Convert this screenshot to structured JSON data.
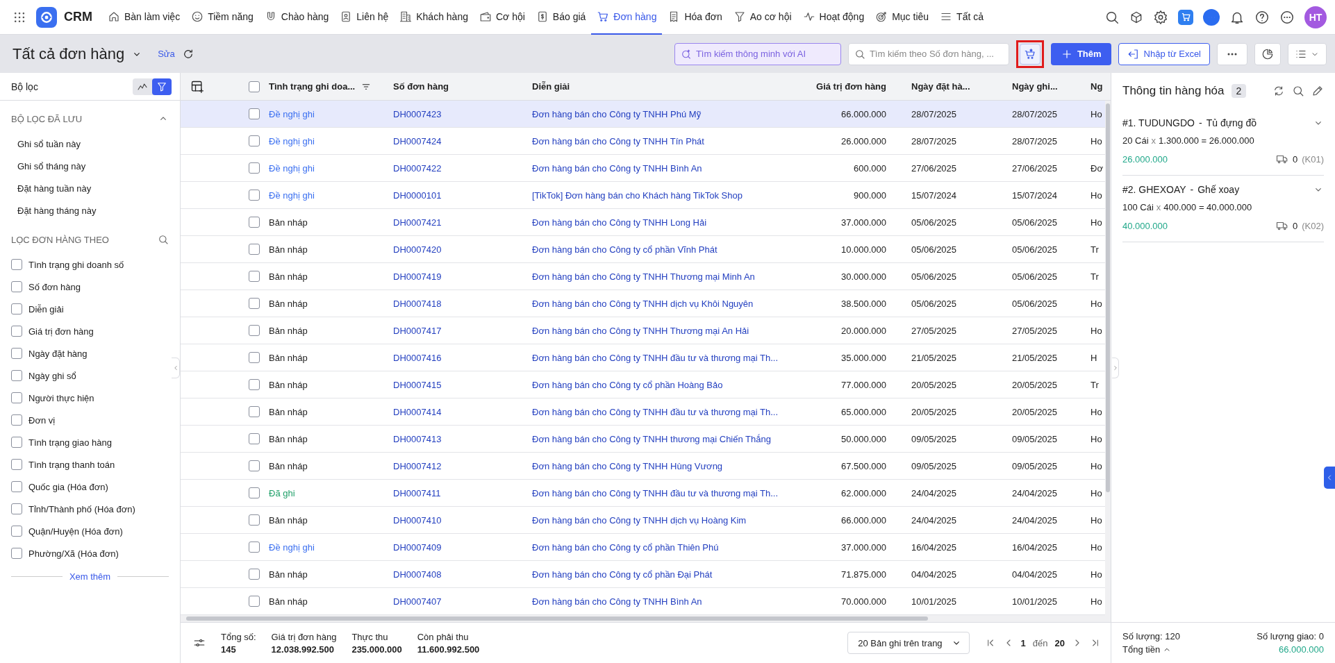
{
  "nav": {
    "brand": "CRM",
    "items": [
      {
        "label": "Bàn làm việc",
        "selected": false
      },
      {
        "label": "Tiềm năng",
        "selected": false
      },
      {
        "label": "Chào hàng",
        "selected": false
      },
      {
        "label": "Liên hệ",
        "selected": false
      },
      {
        "label": "Khách hàng",
        "selected": false
      },
      {
        "label": "Cơ hội",
        "selected": false
      },
      {
        "label": "Báo giá",
        "selected": false
      },
      {
        "label": "Đơn hàng",
        "selected": true
      },
      {
        "label": "Hóa đơn",
        "selected": false
      },
      {
        "label": "Ao cơ hội",
        "selected": false
      },
      {
        "label": "Hoạt động",
        "selected": false
      },
      {
        "label": "Mục tiêu",
        "selected": false
      },
      {
        "label": "Tất cả",
        "selected": false
      }
    ],
    "avatar": "HT"
  },
  "toolbar": {
    "title": "Tất cả đơn hàng",
    "edit_link": "Sửa",
    "ai_search": {
      "placeholder": "Tìm kiếm thông minh với AI"
    },
    "search": {
      "placeholder": "Tìm kiếm theo Số đơn hàng, ..."
    },
    "add_button": "Thêm",
    "import_button": "Nhập từ Excel"
  },
  "sidebar": {
    "title": "Bộ lọc",
    "view_toggle": [
      {
        "selected": false
      },
      {
        "selected": true
      }
    ],
    "saved_filters": {
      "title": "BỘ LỌC ĐÃ LƯU",
      "expanded": true,
      "items": [
        "Ghi sổ tuần này",
        "Ghi sổ tháng này",
        "Đặt hàng tuần này",
        "Đặt hàng tháng này"
      ]
    },
    "filter_by": {
      "title": "LỌC ĐƠN HÀNG THEO",
      "items": [
        {
          "label": "Tình trạng ghi doanh số",
          "checked": false
        },
        {
          "label": "Số đơn hàng",
          "checked": false
        },
        {
          "label": "Diễn giải",
          "checked": false
        },
        {
          "label": "Giá trị đơn hàng",
          "checked": false
        },
        {
          "label": "Ngày đặt hàng",
          "checked": false
        },
        {
          "label": "Ngày ghi sổ",
          "checked": false
        },
        {
          "label": "Người thực hiện",
          "checked": false
        },
        {
          "label": "Đơn vị",
          "checked": false
        },
        {
          "label": "Tình trạng giao hàng",
          "checked": false
        },
        {
          "label": "Tình trạng thanh toán",
          "checked": false
        },
        {
          "label": "Quốc gia (Hóa đơn)",
          "checked": false
        },
        {
          "label": "Tỉnh/Thành phố (Hóa đơn)",
          "checked": false
        },
        {
          "label": "Quận/Huyện (Hóa đơn)",
          "checked": false
        },
        {
          "label": "Phường/Xã (Hóa đơn)",
          "checked": false
        }
      ]
    },
    "more_link": "Xem thêm"
  },
  "table": {
    "select_all_checked": false,
    "columns": [
      "Tình trạng ghi doa...",
      "Số đơn hàng",
      "Diễn giải",
      "Giá trị đơn hàng",
      "Ngày đặt hà...",
      "Ngày ghi...",
      "Ng"
    ],
    "rows": [
      {
        "selected": true,
        "checked": false,
        "status": "Đề nghị ghi",
        "kind": "proposed",
        "number": "DH0007423",
        "description": "Đơn hàng bán cho Công ty TNHH Phú Mỹ",
        "value": "66.000.000",
        "order_date": "28/07/2025",
        "record_date": "28/07/2025",
        "column_7": "Ho"
      },
      {
        "selected": false,
        "checked": false,
        "status": "Đề nghị ghi",
        "kind": "proposed",
        "number": "DH0007424",
        "description": "Đơn hàng bán cho Công ty TNHH Tín Phát",
        "value": "26.000.000",
        "order_date": "28/07/2025",
        "record_date": "28/07/2025",
        "column_7": "Ho"
      },
      {
        "selected": false,
        "checked": false,
        "status": "Đề nghị ghi",
        "kind": "proposed",
        "number": "DH0007422",
        "description": "Đơn hàng bán cho Công ty TNHH Bình An",
        "value": "600.000",
        "order_date": "27/06/2025",
        "record_date": "27/06/2025",
        "column_7": "Đơ"
      },
      {
        "selected": false,
        "checked": false,
        "status": "Đề nghị ghi",
        "kind": "proposed",
        "number": "DH0000101",
        "description": "[TikTok] Đơn hàng bán cho Khách hàng TikTok Shop",
        "value": "900.000",
        "order_date": "15/07/2024",
        "record_date": "15/07/2024",
        "column_7": "Ho"
      },
      {
        "selected": false,
        "checked": false,
        "status": "Bản nháp",
        "kind": "draft",
        "number": "DH0007421",
        "description": "Đơn hàng bán cho Công ty TNHH Long Hải",
        "value": "37.000.000",
        "order_date": "05/06/2025",
        "record_date": "05/06/2025",
        "column_7": "Ho"
      },
      {
        "selected": false,
        "checked": false,
        "status": "Bản nháp",
        "kind": "draft",
        "number": "DH0007420",
        "description": "Đơn hàng bán cho Công ty cổ phần Vĩnh Phát",
        "value": "10.000.000",
        "order_date": "05/06/2025",
        "record_date": "05/06/2025",
        "column_7": "Tr"
      },
      {
        "selected": false,
        "checked": false,
        "status": "Bản nháp",
        "kind": "draft",
        "number": "DH0007419",
        "description": "Đơn hàng bán cho Công ty TNHH Thương mại Minh An",
        "value": "30.000.000",
        "order_date": "05/06/2025",
        "record_date": "05/06/2025",
        "column_7": "Tr"
      },
      {
        "selected": false,
        "checked": false,
        "status": "Bản nháp",
        "kind": "draft",
        "number": "DH0007418",
        "description": "Đơn hàng bán cho Công ty TNHH dịch vụ Khôi Nguyên",
        "value": "38.500.000",
        "order_date": "05/06/2025",
        "record_date": "05/06/2025",
        "column_7": "Ho"
      },
      {
        "selected": false,
        "checked": false,
        "status": "Bản nháp",
        "kind": "draft",
        "number": "DH0007417",
        "description": "Đơn hàng bán cho Công ty TNHH Thương mại An Hải",
        "value": "20.000.000",
        "order_date": "27/05/2025",
        "record_date": "27/05/2025",
        "column_7": "Ho"
      },
      {
        "selected": false,
        "checked": false,
        "status": "Bản nháp",
        "kind": "draft",
        "number": "DH0007416",
        "description": "Đơn hàng bán cho Công ty TNHH đầu tư và thương mại Th...",
        "value": "35.000.000",
        "order_date": "21/05/2025",
        "record_date": "21/05/2025",
        "column_7": "H"
      },
      {
        "selected": false,
        "checked": false,
        "status": "Bản nháp",
        "kind": "draft",
        "number": "DH0007415",
        "description": "Đơn hàng bán cho Công ty cổ phần Hoàng Bảo",
        "value": "77.000.000",
        "order_date": "20/05/2025",
        "record_date": "20/05/2025",
        "column_7": "Tr"
      },
      {
        "selected": false,
        "checked": false,
        "status": "Bản nháp",
        "kind": "draft",
        "number": "DH0007414",
        "description": "Đơn hàng bán cho Công ty TNHH đầu tư và thương mại Th...",
        "value": "65.000.000",
        "order_date": "20/05/2025",
        "record_date": "20/05/2025",
        "column_7": "Ho"
      },
      {
        "selected": false,
        "checked": false,
        "status": "Bản nháp",
        "kind": "draft",
        "number": "DH0007413",
        "description": "Đơn hàng bán cho Công ty TNHH thương mại Chiến Thắng",
        "value": "50.000.000",
        "order_date": "09/05/2025",
        "record_date": "09/05/2025",
        "column_7": "Ho"
      },
      {
        "selected": false,
        "checked": false,
        "status": "Bản nháp",
        "kind": "draft",
        "number": "DH0007412",
        "description": "Đơn hàng bán cho Công ty TNHH Hùng Vương",
        "value": "67.500.000",
        "order_date": "09/05/2025",
        "record_date": "09/05/2025",
        "column_7": "Ho"
      },
      {
        "selected": false,
        "checked": false,
        "status": "Đã ghi",
        "kind": "recorded",
        "number": "DH0007411",
        "description": "Đơn hàng bán cho Công ty TNHH đầu tư và thương mại Th...",
        "value": "62.000.000",
        "order_date": "24/04/2025",
        "record_date": "24/04/2025",
        "column_7": "Ho"
      },
      {
        "selected": false,
        "checked": false,
        "status": "Bản nháp",
        "kind": "draft",
        "number": "DH0007410",
        "description": "Đơn hàng bán cho Công ty TNHH dịch vụ Hoàng Kim",
        "value": "66.000.000",
        "order_date": "24/04/2025",
        "record_date": "24/04/2025",
        "column_7": "Ho"
      },
      {
        "selected": false,
        "checked": false,
        "status": "Đề nghị ghi",
        "kind": "proposed",
        "number": "DH0007409",
        "description": "Đơn hàng bán cho Công ty cổ phần Thiên Phú",
        "value": "37.000.000",
        "order_date": "16/04/2025",
        "record_date": "16/04/2025",
        "column_7": "Ho"
      },
      {
        "selected": false,
        "checked": false,
        "status": "Bản nháp",
        "kind": "draft",
        "number": "DH0007408",
        "description": "Đơn hàng bán cho Công ty cổ phần Đại Phát",
        "value": "71.875.000",
        "order_date": "04/04/2025",
        "record_date": "04/04/2025",
        "column_7": "Ho"
      },
      {
        "selected": false,
        "checked": false,
        "status": "Bản nháp",
        "kind": "draft",
        "number": "DH0007407",
        "description": "Đơn hàng bán cho Công ty TNHH Bình An",
        "value": "70.000.000",
        "order_date": "10/01/2025",
        "record_date": "10/01/2025",
        "column_7": "Ho"
      }
    ]
  },
  "summary": {
    "stats": [
      {
        "label": "Tổng số:",
        "value": "145"
      },
      {
        "label": "Giá trị đơn hàng",
        "value": "12.038.992.500"
      },
      {
        "label": "Thực thu",
        "value": "235.000.000"
      },
      {
        "label": "Còn phải thu",
        "value": "11.600.992.500"
      }
    ],
    "page_size": "20 Bản ghi trên trang",
    "page_from": "1",
    "page_to_label": "đến",
    "page_to": "20"
  },
  "details": {
    "title": "Thông tin hàng hóa",
    "count": "2",
    "items": [
      {
        "name": "#1. TUDUNGDO",
        "dash": "-",
        "product": "Tủ đựng đồ",
        "quantity": "20 Cái",
        "times": "x",
        "formula": "1.300.000 = 26.000.000",
        "amount": "26.000.000",
        "delivered": "0",
        "warehouse": "(K01)"
      },
      {
        "name": "#2. GHEXOAY",
        "dash": "-",
        "product": "Ghế xoay",
        "quantity": "100 Cái",
        "times": "x",
        "formula": "400.000 = 40.000.000",
        "amount": "40.000.000",
        "delivered": "0",
        "warehouse": "(K02)"
      }
    ],
    "total_quantity": "Số lượng: 120",
    "delivered_quantity": "Số lượng giao: 0",
    "total_label": "Tổng tiền",
    "total_expanded": true,
    "total": "66.000.000"
  }
}
